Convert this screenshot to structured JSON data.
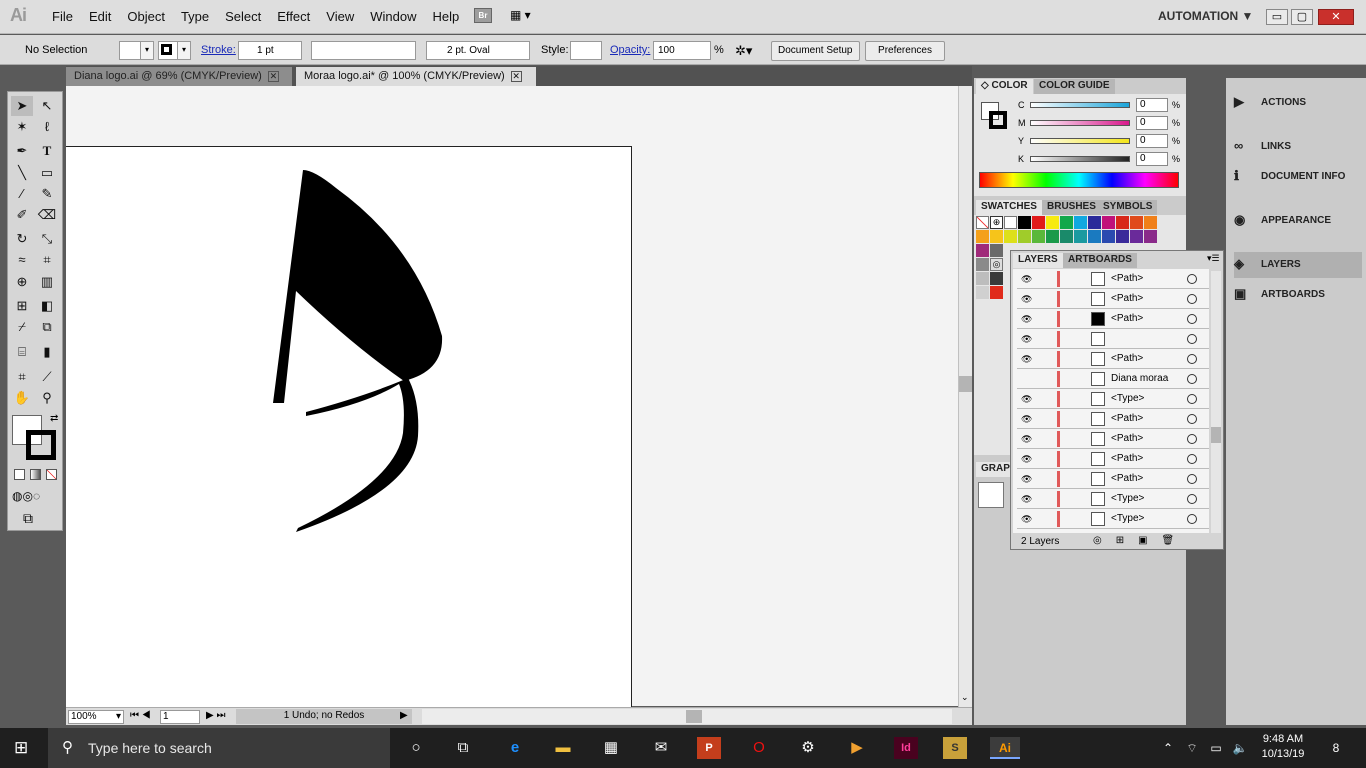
{
  "app": {
    "logo": "Ai"
  },
  "menu": [
    "File",
    "Edit",
    "Object",
    "Type",
    "Select",
    "Effect",
    "View",
    "Window",
    "Help"
  ],
  "bridge_label": "Br",
  "workspace": "AUTOMATION ▼",
  "window_buttons": {
    "min": "▭",
    "max": "▢",
    "close": "✕"
  },
  "control": {
    "selection": "No Selection",
    "stroke_label": "Stroke:",
    "stroke_value": "1 pt",
    "brush": "2 pt. Oval",
    "style_label": "Style:",
    "opacity_label": "Opacity:",
    "opacity_value": "100",
    "percent": "%",
    "document_setup": "Document Setup",
    "preferences": "Preferences"
  },
  "tabs": [
    {
      "label": "Diana logo.ai @ 69% (CMYK/Preview)"
    },
    {
      "label": "Moraa logo.ai* @ 100% (CMYK/Preview)"
    }
  ],
  "status": {
    "zoom": "100%",
    "artboard": "1",
    "history": "1 Undo; no Redos"
  },
  "color_panel": {
    "tab1": "COLOR",
    "tab2": "COLOR GUIDE",
    "channels": [
      {
        "name": "C",
        "value": "0",
        "color": "#1aa3d8"
      },
      {
        "name": "M",
        "value": "0",
        "color": "#d8198c"
      },
      {
        "name": "Y",
        "value": "0",
        "color": "#f3e51a"
      },
      {
        "name": "K",
        "value": "0",
        "color": "#222222"
      }
    ],
    "percent": "%"
  },
  "swatch_panel": {
    "tabs": [
      "SWATCHES",
      "BRUSHES",
      "SYMBOLS"
    ]
  },
  "graphic_label": "GRAP",
  "layers_panel": {
    "tabs": [
      "LAYERS",
      "ARTBOARDS"
    ],
    "rows": [
      {
        "name": "<Path>",
        "visible": true
      },
      {
        "name": "<Path>",
        "visible": true
      },
      {
        "name": "<Path>",
        "visible": true
      },
      {
        "name": "",
        "visible": true
      },
      {
        "name": "<Path>",
        "visible": true
      },
      {
        "name": "Diana moraa",
        "visible": false
      },
      {
        "name": "<Type>",
        "visible": true
      },
      {
        "name": "<Path>",
        "visible": true
      },
      {
        "name": "<Path>",
        "visible": true
      },
      {
        "name": "<Path>",
        "visible": true
      },
      {
        "name": "<Path>",
        "visible": true
      },
      {
        "name": "<Type>",
        "visible": true
      },
      {
        "name": "<Type>",
        "visible": true
      }
    ],
    "footer": "2 Layers"
  },
  "right_panels": [
    {
      "label": "ACTIONS",
      "icon": "▶"
    },
    {
      "label": "LINKS",
      "icon": "∞"
    },
    {
      "label": "DOCUMENT INFO",
      "icon": "ℹ"
    },
    {
      "label": "APPEARANCE",
      "icon": "◉"
    },
    {
      "label": "LAYERS",
      "icon": "◈"
    },
    {
      "label": "ARTBOARDS",
      "icon": "▣"
    }
  ],
  "taskbar": {
    "search_placeholder": "Type here to search",
    "time": "9:48 AM",
    "date": "10/13/19",
    "notifications": "8"
  }
}
